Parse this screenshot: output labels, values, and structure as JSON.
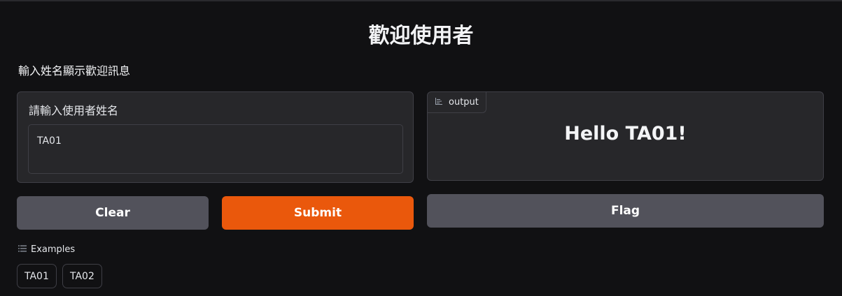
{
  "header": {
    "title": "歡迎使用者",
    "description": "輸入姓名顯示歡迎訊息"
  },
  "input": {
    "label": "請輸入使用者姓名",
    "value": "TA01"
  },
  "output": {
    "label": "output",
    "icon": "text-icon",
    "text": "Hello TA01!"
  },
  "buttons": {
    "clear": "Clear",
    "submit": "Submit",
    "flag": "Flag"
  },
  "examples": {
    "label": "Examples",
    "icon": "list-icon",
    "items": [
      "TA01",
      "TA02"
    ]
  },
  "colors": {
    "background": "#111113",
    "panel": "#27272a",
    "primary": "#ea580c",
    "secondary": "#52525b"
  }
}
